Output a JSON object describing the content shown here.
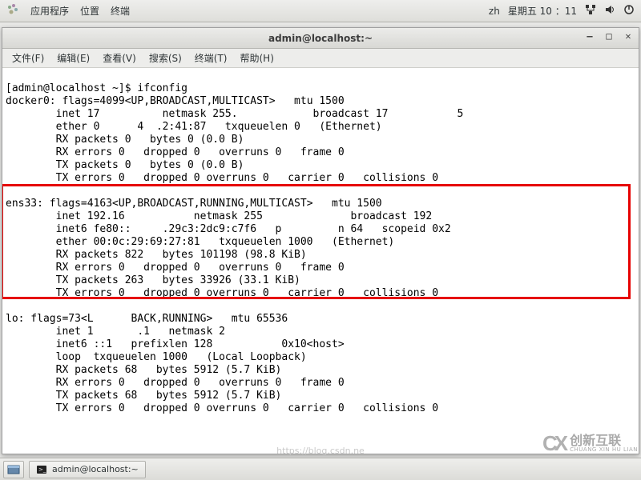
{
  "topbar": {
    "apps": "应用程序",
    "places": "位置",
    "terminal": "终端",
    "lang": "zh",
    "clock": "星期五 10 ：11"
  },
  "window": {
    "title": "admin@localhost:~"
  },
  "menubar": {
    "file": "文件(F)",
    "edit": "编辑(E)",
    "view": "查看(V)",
    "search": "搜索(S)",
    "terminal": "终端(T)",
    "help": "帮助(H)"
  },
  "terminal": {
    "prompt": "[admin@localhost ~]$ ",
    "command": "ifconfig",
    "docker0": {
      "name": "docker0:",
      "flags": " flags=4099<UP,BROADCAST,MULTICAST>   mtu 1500",
      "inet": "        inet 17          netmask 255.            broadcast 17           5",
      "ether": "        ether 0      4  .2:41:87   txqueuelen 0   (Ethernet)",
      "rxp": "        RX packets 0   bytes 0 (0.0 B)",
      "rxe": "        RX errors 0   dropped 0   overruns 0   frame 0",
      "txp": "        TX packets 0   bytes 0 (0.0 B)",
      "txe": "        TX errors 0   dropped 0 overruns 0   carrier 0   collisions 0"
    },
    "ens33": {
      "name": "ens33:",
      "flags": " flags=4163<UP,BROADCAST,RUNNING,MULTICAST>   mtu 1500",
      "inet": "        inet 192.16           netmask 255              broadcast 192          ",
      "inet6": "        inet6 fe80::     .29c3:2dc9:c7f6   p         n 64   scopeid 0x2       ",
      "ether": "        ether 00:0c:29:69:27:81   txqueuelen 1000   (Ethernet)",
      "rxp": "        RX packets 822   bytes 101198 (98.8 KiB)",
      "rxe": "        RX errors 0   dropped 0   overruns 0   frame 0",
      "txp": "        TX packets 263   bytes 33926 (33.1 KiB)",
      "txe": "        TX errors 0   dropped 0 overruns 0   carrier 0   collisions 0"
    },
    "lo": {
      "name": "lo:",
      "flags": " flags=73<L      BACK,RUNNING>   mtu 65536",
      "inet": "        inet 1       .1   netmask 2               ",
      "inet6": "        inet6 ::1   prefixlen 128           0x10<host>",
      "loop": "        loop  txqueuelen 1000   (Local Loopback)",
      "rxp": "        RX packets 68   bytes 5912 (5.7 KiB)",
      "rxe": "        RX errors 0   dropped 0   overruns 0   frame 0",
      "txp": "        TX packets 68   bytes 5912 (5.7 KiB)",
      "txe": "        TX errors 0   dropped 0 overruns 0   carrier 0   collisions 0"
    }
  },
  "taskbar": {
    "task1": "admin@localhost:~"
  },
  "watermark": {
    "csdn": "https://blog.csdn.ne",
    "brand": "创新互联",
    "brand_sub": "CHUANG XIN HU LIAN"
  }
}
